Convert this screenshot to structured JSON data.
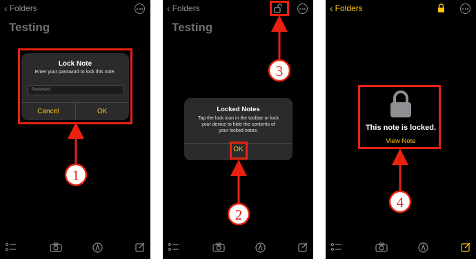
{
  "panel1": {
    "back_label": "Folders",
    "title": "Testing",
    "dialog": {
      "title": "Lock Note",
      "message": "Enter your password to lock this note.",
      "password_placeholder": "Password",
      "cancel_label": "Cancel",
      "ok_label": "OK"
    },
    "step_number": "1"
  },
  "panel2": {
    "back_label": "Folders",
    "title": "Testing",
    "dialog": {
      "title": "Locked Notes",
      "message_lines": [
        "Tap the lock icon in the toolbar or lock",
        "your device to hide the contents of",
        "your locked notes."
      ],
      "ok_label": "OK"
    },
    "step_numbers": [
      "2",
      "3"
    ]
  },
  "panel3": {
    "back_label": "Folders",
    "locked_message": "This note is locked.",
    "view_note_label": "View Note",
    "step_number": "4"
  },
  "colors": {
    "accent": "#ffc507",
    "annotation_red": "#e8220f",
    "dialog_bg": "#2b2b2d",
    "background": "#000000"
  },
  "icons": [
    "chevron-left-icon",
    "more-icon",
    "unlock-icon",
    "lock-icon",
    "checklist-icon",
    "camera-icon",
    "compass-icon",
    "compose-icon"
  ]
}
